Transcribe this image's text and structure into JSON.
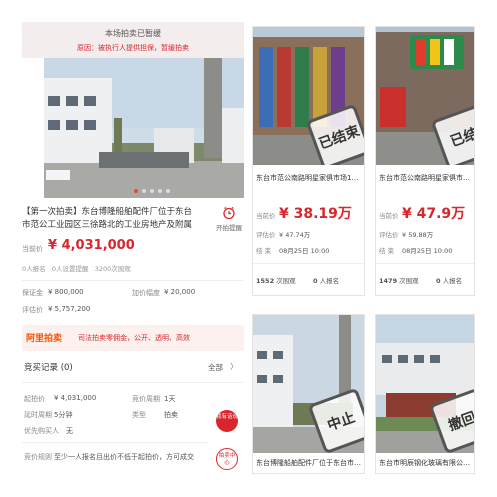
{
  "left_panel": {
    "banner_title": "本场拍卖已暂缓",
    "banner_reason": "原因：被执行人提供担保，暂缓拍卖",
    "gallery_total_dots": 5,
    "title": "【第一次拍卖】东台博隆船舶配件厂位于东台市范公工业园区三徐路北的工业房地产及附属设施",
    "reminder_label": "开拍提醒",
    "current_price_label": "当前价",
    "current_price": "¥ 4,031,000",
    "stats": [
      "0人报名",
      "0人设置提醒",
      "3200次围观"
    ],
    "deposit_label": "保证金",
    "deposit_value": "¥ 800,000",
    "increment_label": "加价幅度",
    "increment_value": "¥ 20,000",
    "appraisal_label": "评估价",
    "appraisal_value": "¥ 5,757,200",
    "brand_logo": "阿里拍卖",
    "brand_slogan": "司法拍卖零佣金，公开、透明、高效",
    "records_label": "竞买记录 (0)",
    "records_all": "全部",
    "records_chevron": "〉",
    "details": [
      {
        "label": "起拍价",
        "value": "¥ 4,031,000"
      },
      {
        "label": "竞价周期",
        "value": "1天"
      },
      {
        "label": "延时周期",
        "value": "5分钟"
      },
      {
        "label": "类型",
        "value": "拍卖"
      },
      {
        "label": "优先购买人",
        "value": "无"
      }
    ],
    "rule_label": "竞价规则",
    "rule_text": "至少一人报名且出价不低于起拍价，方可成交",
    "fab1": "我有话说",
    "fab2": "拍卖中心"
  },
  "cards": [
    {
      "title": "东台市范公南路明星家俱市场1幢2176...",
      "stamp": "已结束",
      "current_label": "当前价",
      "current_price": "¥ 38.19万",
      "appraisal_label": "评估价",
      "appraisal": "¥ 47.74万",
      "end_label": "结 束",
      "end_time": "08月25日 10:00",
      "views": "1552",
      "views_label": "次围观",
      "signups": "0",
      "signups_label": "人报名"
    },
    {
      "title": "东台市范公南路明星家俱市场1幢2176...",
      "stamp": "已结",
      "current_label": "当前价",
      "current_price": "¥ 47.9万",
      "appraisal_label": "评估价",
      "appraisal": "¥ 59.88万",
      "end_label": "结 束",
      "end_time": "08月25日 10:00",
      "views": "1479",
      "views_label": "次围观",
      "signups": "0",
      "signups_label": "人报名"
    },
    {
      "title": "东台博隆船舶配件厂位于东台市范公工...",
      "stamp": "中止"
    },
    {
      "title": "东台市明辰钢化玻璃有限公司位于东台...",
      "stamp": "撤回"
    }
  ],
  "colors": {
    "accent": "#d9262c",
    "banner_bg": "#f3eded",
    "brand_orange": "#ff5000"
  }
}
